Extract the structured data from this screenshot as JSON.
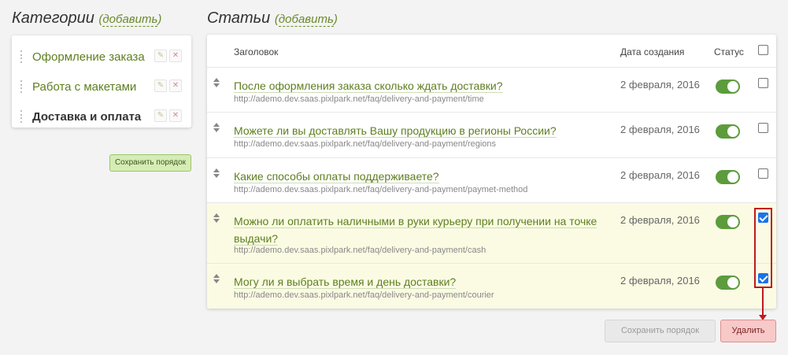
{
  "categories": {
    "title": "Категории",
    "add_label": "добавить",
    "items": [
      {
        "label": "Оформление заказа",
        "active": false
      },
      {
        "label": "Работа с макетами",
        "active": false
      },
      {
        "label": "Доставка и оплата",
        "active": true
      }
    ],
    "save_order_label": "Сохранить порядок"
  },
  "articles": {
    "title": "Статьи",
    "add_label": "добавить",
    "columns": {
      "title": "Заголовок",
      "date": "Дата создания",
      "status": "Статус"
    },
    "rows": [
      {
        "title": "После оформления заказа сколько ждать доставки?",
        "url": "http://ademo.dev.saas.pixlpark.net/faq/delivery-and-payment/time",
        "date": "2 февраля, 2016",
        "status_on": true,
        "checked": false
      },
      {
        "title": "Можете ли вы доставлять Вашу продукцию в регионы России?",
        "url": "http://ademo.dev.saas.pixlpark.net/faq/delivery-and-payment/regions",
        "date": "2 февраля, 2016",
        "status_on": true,
        "checked": false
      },
      {
        "title": "Какие способы оплаты поддерживаете?",
        "url": "http://ademo.dev.saas.pixlpark.net/faq/delivery-and-payment/paymet-method",
        "date": "2 февраля, 2016",
        "status_on": true,
        "checked": false
      },
      {
        "title": "Можно ли оплатить наличными в руки курьеру при получении на точке выдачи?",
        "url": "http://ademo.dev.saas.pixlpark.net/faq/delivery-and-payment/cash",
        "date": "2 февраля, 2016",
        "status_on": true,
        "checked": true
      },
      {
        "title": "Могу ли я выбрать время и день доставки?",
        "url": "http://ademo.dev.saas.pixlpark.net/faq/delivery-and-payment/courier",
        "date": "2 февраля, 2016",
        "status_on": true,
        "checked": true
      }
    ],
    "save_order_label": "Сохранить порядок",
    "delete_label": "Удалить"
  },
  "colors": {
    "accent_green": "#5d7f1f",
    "toggle_on": "#5c9c3c",
    "annotation_red": "#c0191d",
    "selected_row": "#fbfbe3"
  }
}
